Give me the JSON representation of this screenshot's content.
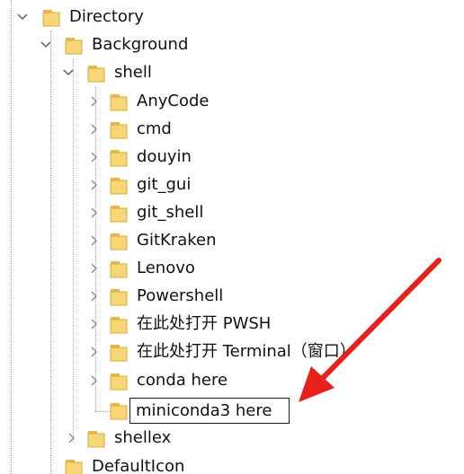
{
  "tree": {
    "directory": "Directory",
    "background": "Background",
    "shell": "shell",
    "shell_children": [
      "AnyCode",
      "cmd",
      "douyin",
      "git_gui",
      "git_shell",
      "GitKraken",
      "Lenovo",
      "Powershell",
      "在此处打开 PWSH",
      "在此处打开 Terminal（窗口）",
      "conda here"
    ],
    "rename_value": "miniconda3 here",
    "shellex": "shellex",
    "default_icon": "DefaultIcon"
  },
  "colors": {
    "folder_fill": "#f7d675",
    "folder_back": "#e8b84a",
    "chevron": "#7a7a7a",
    "arrow": "#e8201c"
  },
  "icons": {
    "folder": "folder-icon",
    "expanded": "chevron-down-icon",
    "collapsed": "chevron-right-icon",
    "annotation": "red-arrow-icon"
  }
}
